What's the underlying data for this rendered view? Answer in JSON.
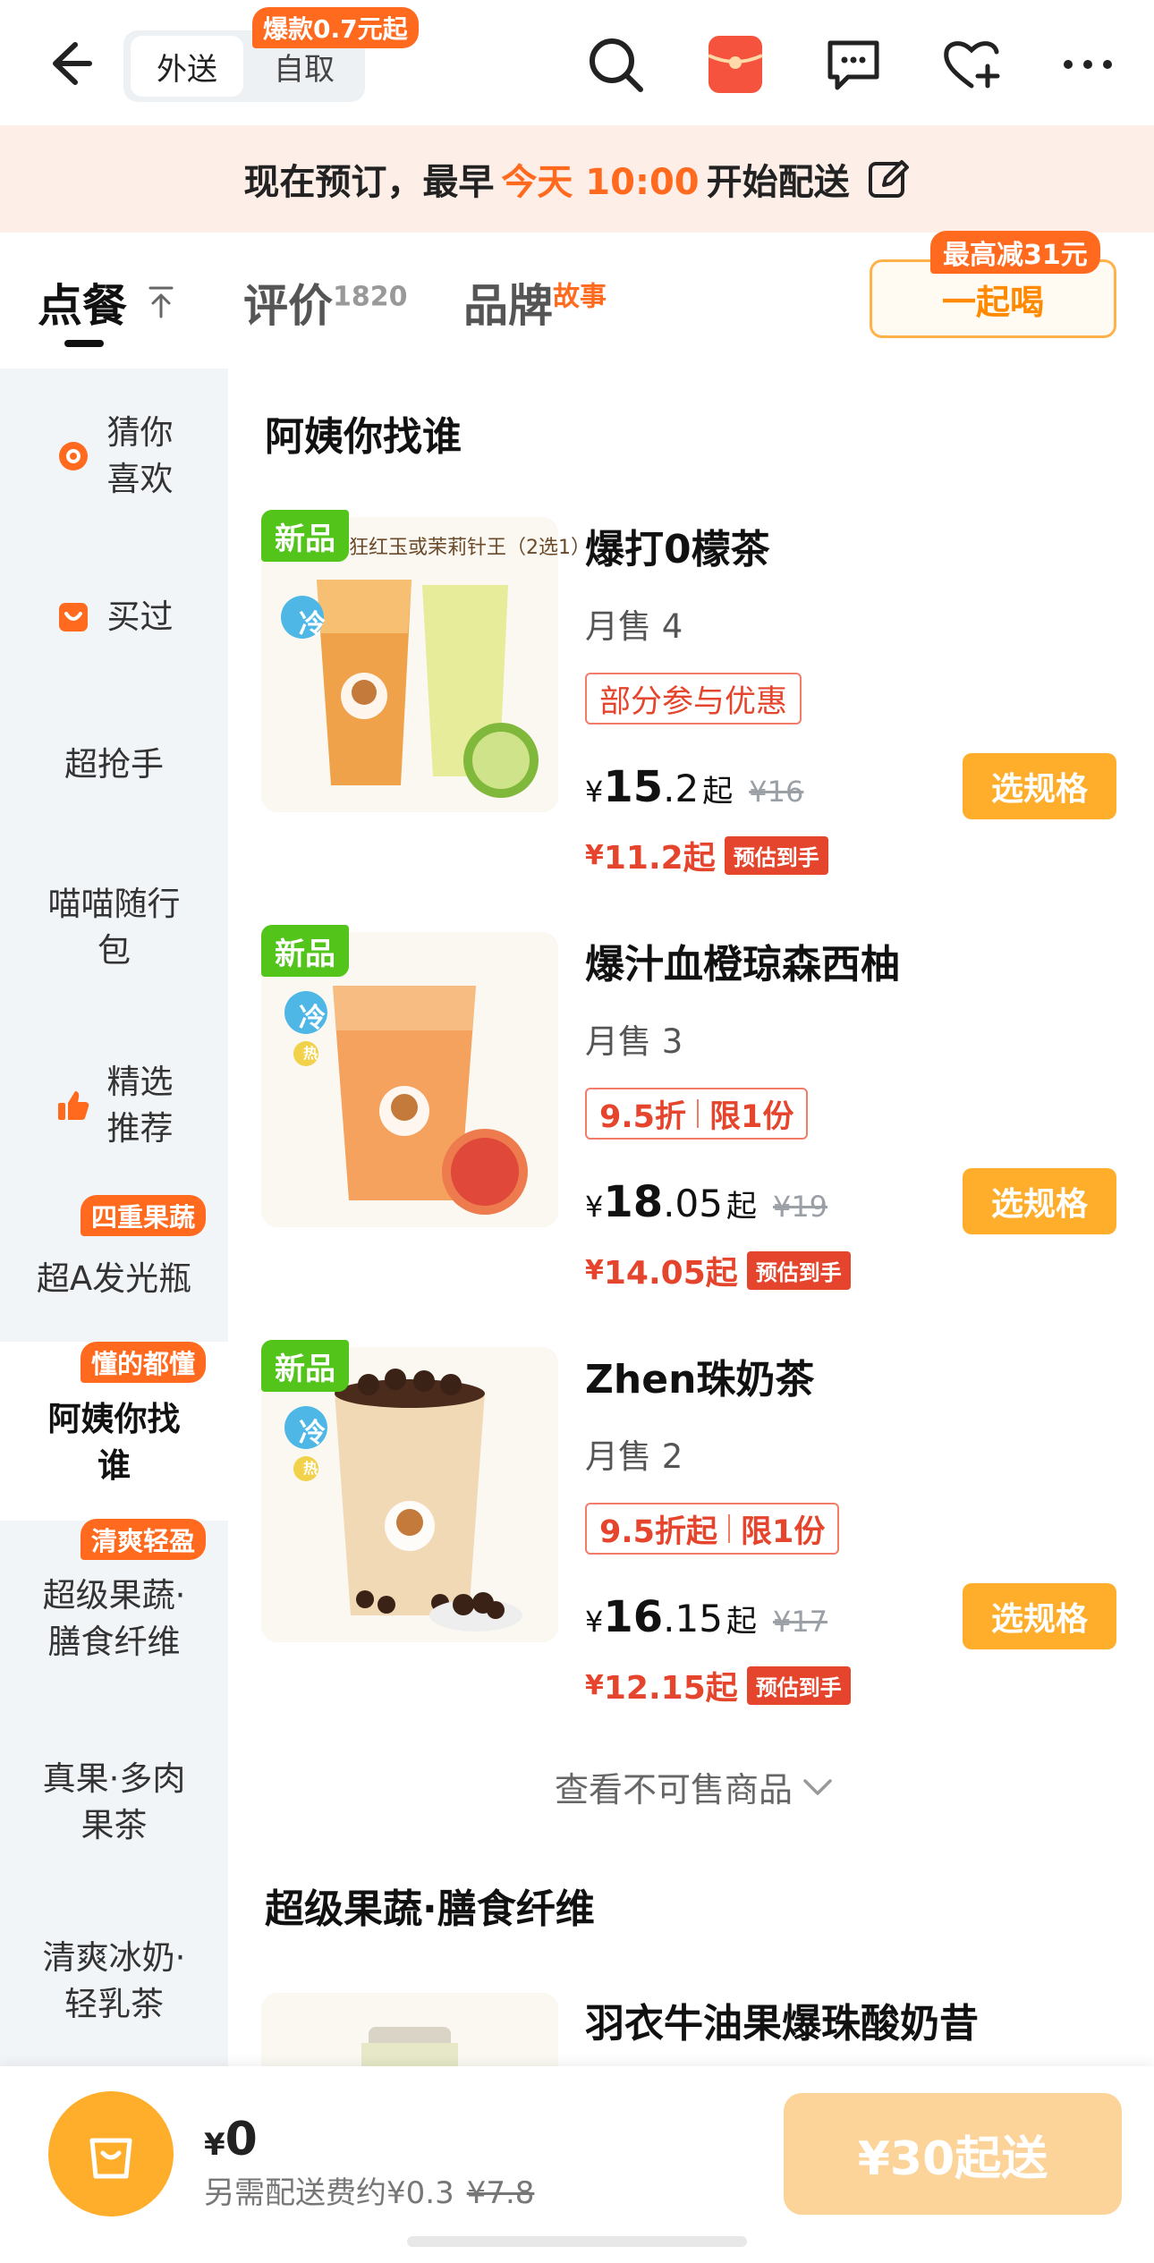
{
  "topbar": {
    "mode_delivery": "外送",
    "mode_pickup": "自取",
    "pickup_badge": "爆款0.7元起",
    "icons": [
      "back-arrow-icon",
      "search-icon",
      "red-packet-icon",
      "message-icon",
      "favorite-add-icon",
      "more-icon"
    ]
  },
  "notice": {
    "prefix": "现在预订，最早",
    "highlight": "今天 10:00",
    "suffix": "开始配送"
  },
  "tabs": {
    "order": "点餐",
    "reviews": "评价",
    "reviews_count": "1820",
    "brand": "品牌",
    "brand_sup": "故事",
    "together_btn": "一起喝",
    "together_badge": "最高减31元"
  },
  "sidebar": {
    "items": [
      {
        "label_1": "猜你",
        "label_2": "喜欢",
        "icon": "guess-like-icon"
      },
      {
        "label": "买过",
        "icon": "bought-icon"
      },
      {
        "label": "超抢手"
      },
      {
        "label_1": "喵喵随行",
        "label_2": "包"
      },
      {
        "label_1": "精选",
        "label_2": "推荐",
        "icon": "thumbs-up-icon"
      },
      {
        "label": "超A发光瓶",
        "badge": "四重果蔬"
      },
      {
        "label_1": "阿姨你找",
        "label_2": "谁",
        "badge": "懂的都懂",
        "active": true
      },
      {
        "label_1": "超级果蔬·",
        "label_2": "膳食纤维",
        "badge": "清爽轻盈"
      },
      {
        "label_1": "真果·多肉",
        "label_2": "果茶"
      },
      {
        "label_1": "清爽冰奶·",
        "label_2": "轻乳茶"
      }
    ]
  },
  "sections": {
    "s1_title": "阿姨你找谁",
    "s2_title": "超级果蔬·膳食纤维",
    "unsellable": "查看不可售商品"
  },
  "products": [
    {
      "new_badge": "新品",
      "img_caption": "狂红玉或茉莉针王（2选1）",
      "cold_tag": "冷",
      "name": "爆打0檬茶",
      "sales": "月售 4",
      "promo_1": "部分参与优惠",
      "cur": "¥",
      "price_int": "15",
      "price_dec": ".2",
      "qi": "起",
      "orig": "¥16",
      "final_cur": "¥",
      "final_price": "11.2起",
      "final_tag": "预估到手",
      "button": "选规格"
    },
    {
      "new_badge": "新品",
      "cold_tag": "冷",
      "hot_tag": "热",
      "name": "爆汁血橙琼森西柚",
      "sales": "月售 3",
      "promo_1": "9.5折",
      "promo_2": "限1份",
      "cur": "¥",
      "price_int": "18",
      "price_dec": ".05",
      "qi": "起",
      "orig": "¥19",
      "final_cur": "¥",
      "final_price": "14.05起",
      "final_tag": "预估到手",
      "button": "选规格"
    },
    {
      "new_badge": "新品",
      "cold_tag": "冷",
      "hot_tag": "热",
      "name": "Zhen珠奶茶",
      "sales": "月售 2",
      "promo_1": "9.5折起",
      "promo_2": "限1份",
      "cur": "¥",
      "price_int": "16",
      "price_dec": ".15",
      "qi": "起",
      "orig": "¥17",
      "final_cur": "¥",
      "final_price": "12.15起",
      "final_tag": "预估到手",
      "button": "选规格"
    },
    {
      "name": "羽衣牛油果爆珠酸奶昔"
    }
  ],
  "bottom": {
    "cur": "¥",
    "total": "0",
    "fee_text": "另需配送费约¥0.3",
    "fee_orig": "¥7.8",
    "min_order": "¥30起送"
  },
  "colors": {
    "accent_orange": "#ff6a1f",
    "button_orange": "#ffae2c",
    "price_red": "#e5452c",
    "new_green": "#52c41a",
    "notice_bg": "#fdeee8",
    "sidebar_bg": "#f2f5f8"
  }
}
